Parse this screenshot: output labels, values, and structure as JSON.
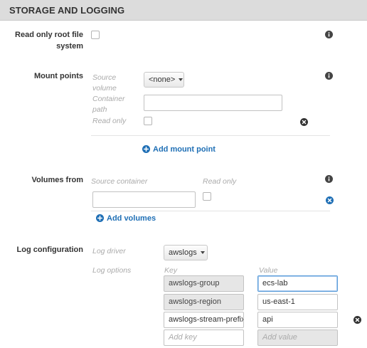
{
  "section": {
    "title": "STORAGE AND LOGGING"
  },
  "readonly_root": {
    "label_line1": "Read only root file",
    "label_line2": "system",
    "checked": false
  },
  "mount_points": {
    "label": "Mount points",
    "source_volume_label_line1": "Source",
    "source_volume_label_line2": "volume",
    "source_volume_value": "<none>",
    "container_path_label_line1": "Container",
    "container_path_label_line2": "path",
    "container_path_value": "",
    "read_only_label": "Read only",
    "add_label": "Add mount point"
  },
  "volumes_from": {
    "label": "Volumes from",
    "source_container_header": "Source container",
    "read_only_header": "Read only",
    "source_container_value": "",
    "add_label": "Add volumes"
  },
  "log_configuration": {
    "label": "Log configuration",
    "log_driver_label": "Log driver",
    "log_driver_value": "awslogs",
    "log_options_label": "Log options",
    "key_header": "Key",
    "value_header": "Value",
    "options": [
      {
        "key": "awslogs-group",
        "value": "ecs-lab"
      },
      {
        "key": "awslogs-region",
        "value": "us-east-1"
      },
      {
        "key": "awslogs-stream-prefix",
        "value": "api"
      }
    ],
    "add_key_placeholder": "Add key",
    "add_value_placeholder": "Add value"
  },
  "colors": {
    "header_bg": "#dcdcdc",
    "link": "#1f6fb5",
    "info_icon": "#444444",
    "remove_blue": "#1f6fb5"
  },
  "icons": {
    "info": "info-icon",
    "remove": "remove-icon",
    "add": "add-circle-icon",
    "caret": "chevron-down-icon"
  }
}
